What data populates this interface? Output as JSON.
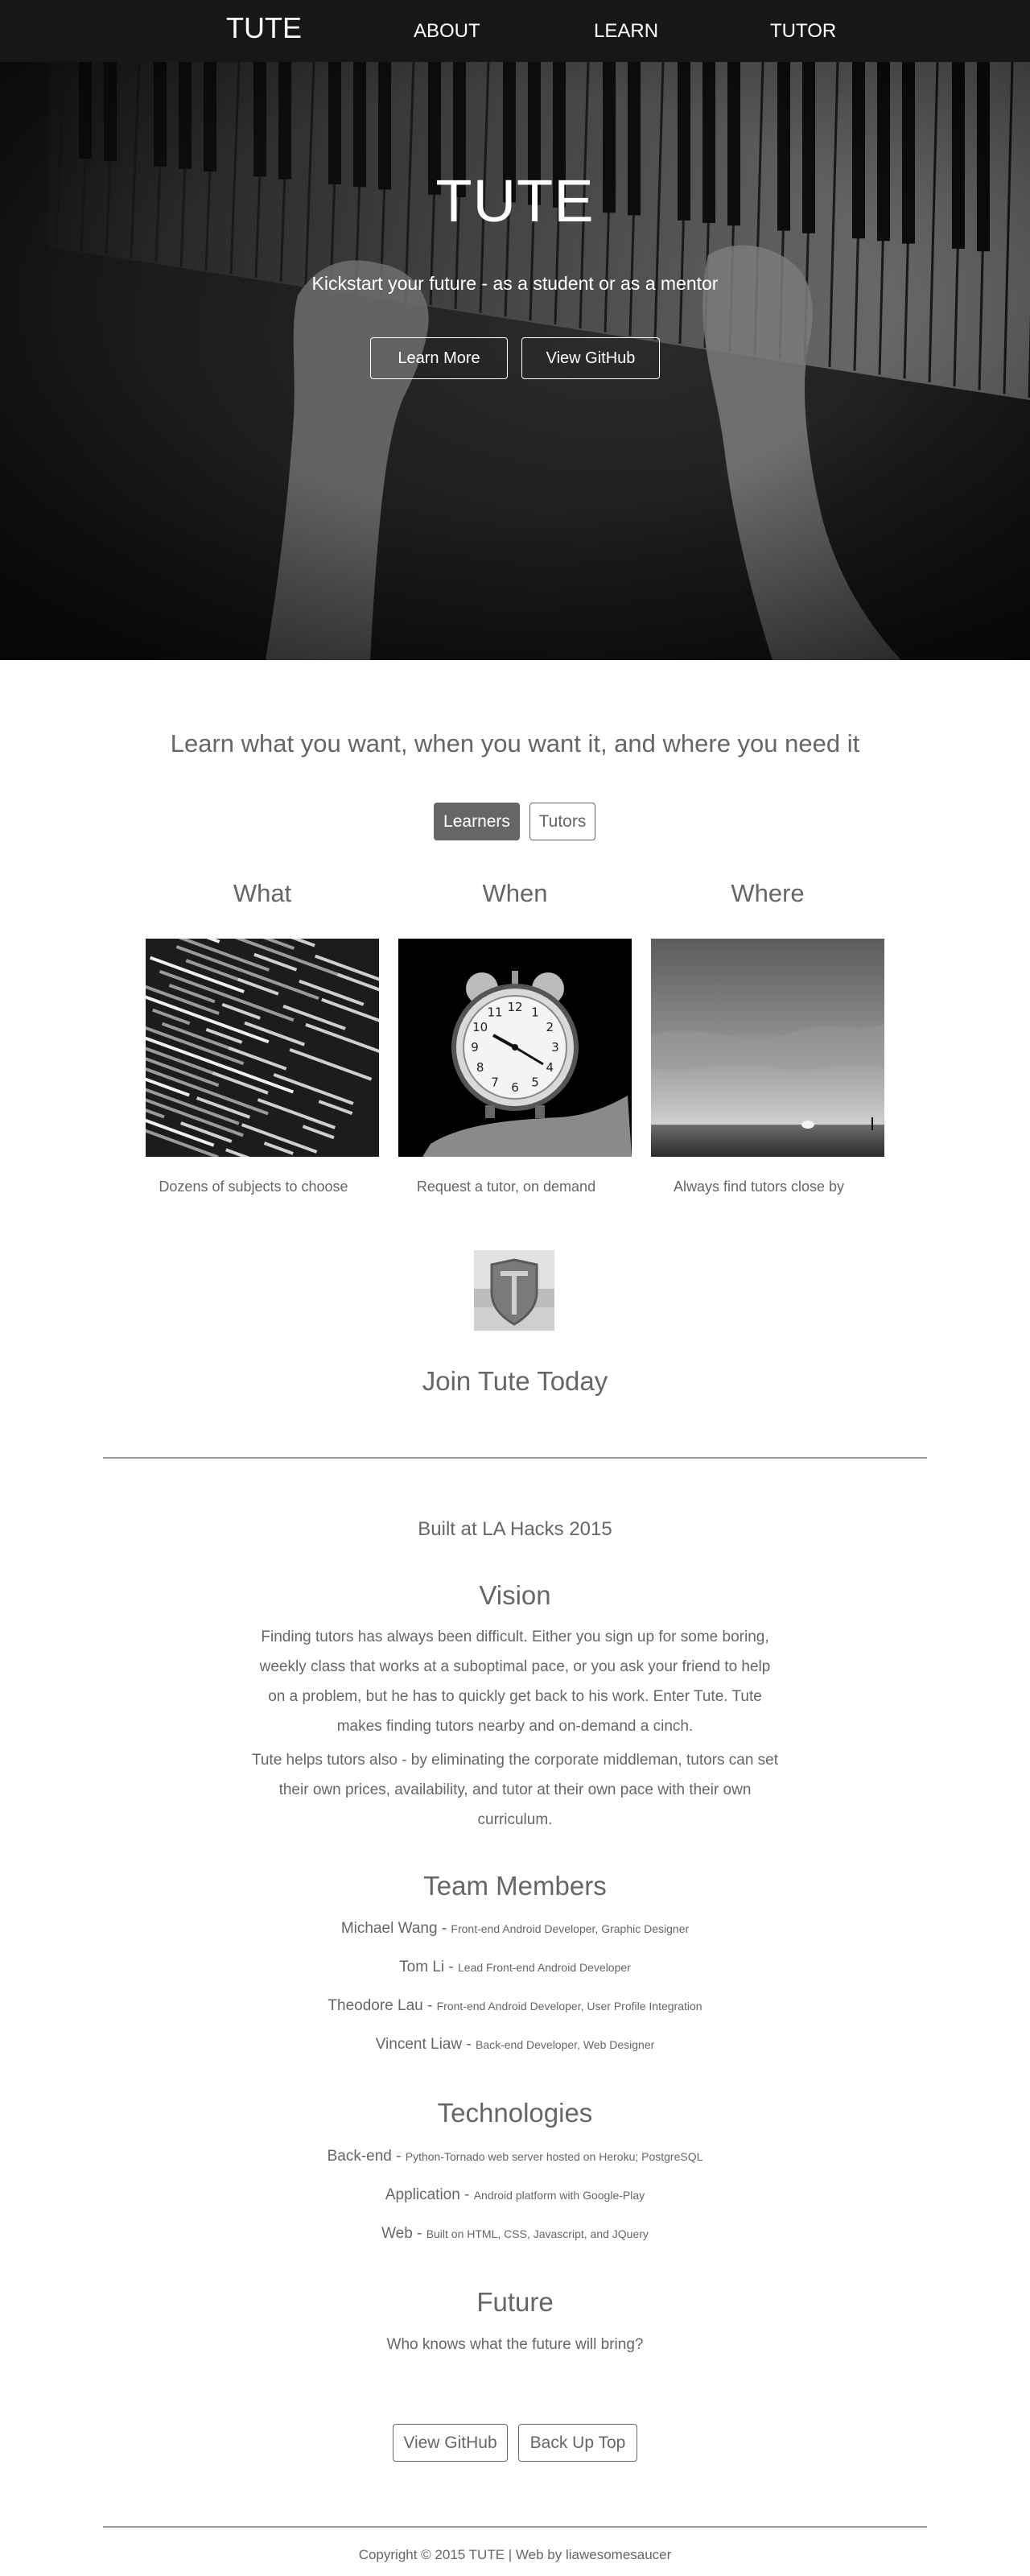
{
  "navbar": {
    "brand": "TUTE",
    "links": [
      "ABOUT",
      "LEARN",
      "TUTOR"
    ]
  },
  "hero": {
    "title": "TUTE",
    "subtitle": "Kickstart your future - as a student or as a mentor",
    "buttons": [
      "Learn More",
      "View GitHub"
    ]
  },
  "learn": {
    "tagline": "Learn what you want, when you want it, and where you need it",
    "toggle": {
      "active": "Learners",
      "inactive": "Tutors"
    },
    "columns": [
      {
        "heading": "What",
        "caption": "Dozens of subjects to choose",
        "image": "code-screen-photo"
      },
      {
        "heading": "When",
        "caption": "Request a tutor, on demand",
        "image": "alarm-clock-photo"
      },
      {
        "heading": "Where",
        "caption": "Always find tutors close by",
        "image": "sunset-sea-photo"
      }
    ],
    "join": "Join Tute Today"
  },
  "about": {
    "built": "Built at LA Hacks 2015",
    "vision_heading": "Vision",
    "vision_paragraphs": [
      "Finding tutors has always been difficult. Either you sign up for some boring, weekly class that works at a suboptimal pace, or you ask your friend to help on a problem, but he has to quickly get back to his work. Enter Tute. Tute makes finding tutors nearby and on-demand a cinch.",
      "Tute helps tutors also - by eliminating the corporate middleman, tutors can set their own prices, availability, and tutor at their own pace with their own curriculum."
    ],
    "team_heading": "Team Members",
    "team": [
      {
        "name": "Michael Wang - ",
        "role": "Front-end Android Developer, Graphic Designer"
      },
      {
        "name": "Tom Li - ",
        "role": "Lead Front-end Android Developer"
      },
      {
        "name": "Theodore Lau - ",
        "role": "Front-end Android Developer, User Profile Integration"
      },
      {
        "name": "Vincent Liaw - ",
        "role": "Back-end Developer, Web Designer"
      }
    ],
    "tech_heading": "Technologies",
    "tech": [
      {
        "name": "Back-end - ",
        "desc": "Python-Tornado web server hosted on Heroku; PostgreSQL"
      },
      {
        "name": "Application - ",
        "desc": "Android platform with Google-Play"
      },
      {
        "name": "Web - ",
        "desc": "Built on HTML, CSS, Javascript, and JQuery"
      }
    ],
    "future_heading": "Future",
    "future_text": "Who knows what the future will bring?",
    "buttons": [
      "View GitHub",
      "Back Up Top"
    ]
  },
  "footer": {
    "text": "Copyright © 2015 TUTE | Web by liawesomesaucer"
  },
  "colors": {
    "navbar_bg": "#171717",
    "text": "#666666",
    "active_toggle": "#666666",
    "divider": "#999999"
  }
}
